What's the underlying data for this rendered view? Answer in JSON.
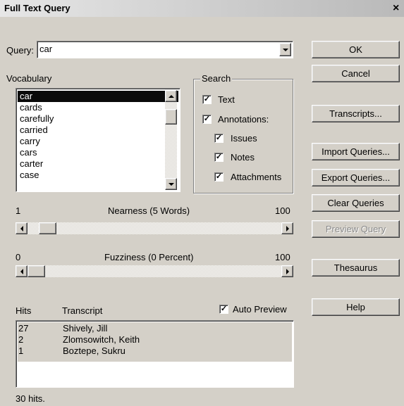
{
  "dialog": {
    "title": "Full Text Query",
    "close_glyph": "×"
  },
  "query": {
    "label": "Query:",
    "value": "car"
  },
  "vocabulary": {
    "label": "Vocabulary",
    "items": [
      "car",
      "cards",
      "carefully",
      "carried",
      "carry",
      "cars",
      "carter",
      "case"
    ],
    "selected_index": 0
  },
  "search": {
    "label": "Search",
    "text": {
      "label": "Text",
      "checked": true
    },
    "annotations": {
      "label": "Annotations:",
      "checked": true
    },
    "issues": {
      "label": "Issues",
      "checked": true
    },
    "notes": {
      "label": "Notes",
      "checked": true
    },
    "attachments": {
      "label": "Attachments",
      "checked": true
    }
  },
  "nearness": {
    "min": "1",
    "label": "Nearness (5 Words)",
    "max": "100",
    "value": 5
  },
  "fuzziness": {
    "min": "0",
    "label": "Fuzziness (0 Percent)",
    "max": "100",
    "value": 0
  },
  "results": {
    "hits_header": "Hits",
    "transcript_header": "Transcript",
    "auto_preview": {
      "label": "Auto Preview",
      "checked": true
    },
    "rows": [
      {
        "hits": "27",
        "transcript": "Shively, Jill"
      },
      {
        "hits": "2",
        "transcript": "Zlomsowitch, Keith"
      },
      {
        "hits": "1",
        "transcript": "Boztepe, Sukru"
      }
    ],
    "status": "30 hits."
  },
  "buttons": {
    "ok": "OK",
    "cancel": "Cancel",
    "transcripts": "Transcripts...",
    "import": "Import Queries...",
    "export": "Export Queries...",
    "clear": "Clear Queries",
    "preview": "Preview Query",
    "thesaurus": "Thesaurus",
    "help": "Help"
  }
}
